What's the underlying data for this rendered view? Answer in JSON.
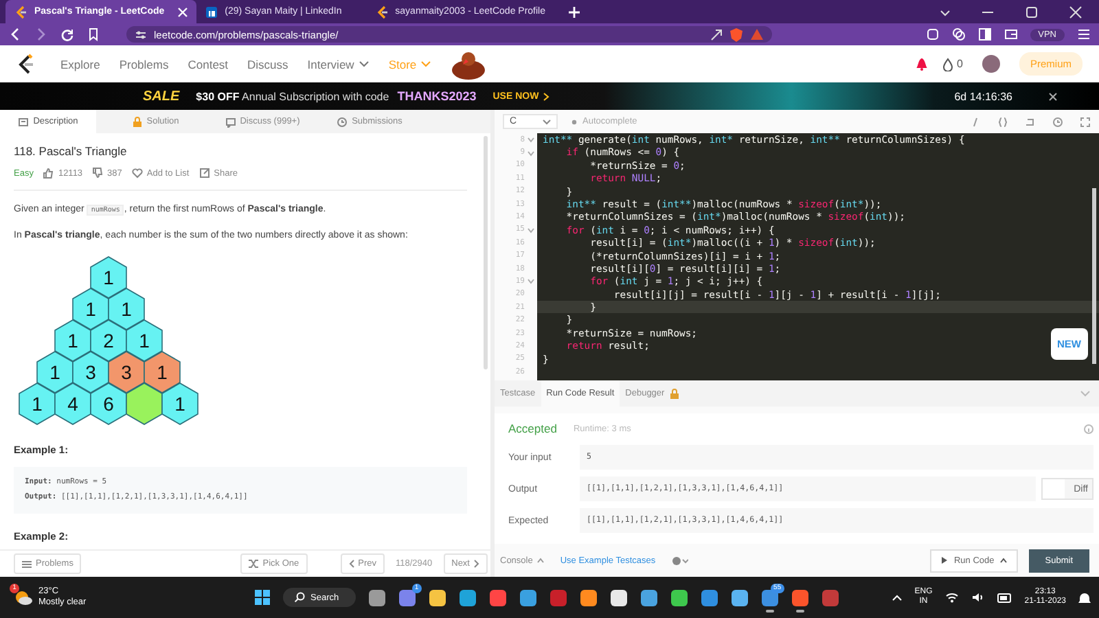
{
  "browser": {
    "tabs": [
      {
        "title": "Pascal's Triangle - LeetCode",
        "selected": true
      },
      {
        "title": "(29) Sayan Maity | LinkedIn",
        "selected": false
      },
      {
        "title": "sayanmaity2003 - LeetCode Profile",
        "selected": false
      }
    ],
    "address": "leetcode.com/problems/pascals-triangle/",
    "vpn": "VPN"
  },
  "nav": {
    "items": [
      {
        "label": "Explore",
        "kind": "plain"
      },
      {
        "label": "Problems",
        "kind": "plain"
      },
      {
        "label": "Contest",
        "kind": "plain"
      },
      {
        "label": "Discuss",
        "kind": "plain"
      },
      {
        "label": "Interview",
        "kind": "menu"
      },
      {
        "label": "Store",
        "kind": "store"
      }
    ],
    "coins": "0",
    "premium": "Premium"
  },
  "promo": {
    "sale": "SALE",
    "text": "**$30 OFF** Annual Subscription with code",
    "code": "THANKS2023",
    "action": "USE NOW",
    "timer": "6d 14:16:36"
  },
  "panel_tabs": [
    {
      "label": "Description",
      "selected": true
    },
    {
      "label": "Solution",
      "selected": false
    },
    {
      "label": "Discuss (999+)",
      "selected": false
    },
    {
      "label": "Submissions",
      "selected": false
    }
  ],
  "problem": {
    "title": "118. Pascal's Triangle",
    "difficulty": "Easy",
    "likes": "12113",
    "dislikes": "387",
    "add_to_list": "Add to List",
    "share": "Share",
    "paragraphs": [
      [
        {
          "kind": "text",
          "text": "Given an integer "
        },
        {
          "kind": "code",
          "text": "numRows"
        },
        {
          "kind": "text",
          "text": ", return the first numRows of **Pascal's triangle**."
        }
      ],
      [
        {
          "kind": "text",
          "text": "In **Pascal's triangle**, each number is the sum of the two numbers directly above it as shown:"
        }
      ]
    ],
    "figure": {
      "rows": [
        [
          {
            "label": "1",
            "color": "#66f2f2"
          }
        ],
        [
          {
            "label": "1",
            "color": "#66f2f2"
          },
          {
            "label": "1",
            "color": "#66f2f2"
          }
        ],
        [
          {
            "label": "1",
            "color": "#66f2f2"
          },
          {
            "label": "2",
            "color": "#66f2f2"
          },
          {
            "label": "1",
            "color": "#66f2f2"
          }
        ],
        [
          {
            "label": "1",
            "color": "#66f2f2"
          },
          {
            "label": "3",
            "color": "#66f2f2"
          },
          {
            "label": "3",
            "color": "#f2966b"
          },
          {
            "label": "1",
            "color": "#f2966b"
          }
        ],
        [
          {
            "label": "1",
            "color": "#66f2f2"
          },
          {
            "label": "4",
            "color": "#66f2f2"
          },
          {
            "label": "6",
            "color": "#66f2f2"
          },
          {
            "color": "#99f25c"
          },
          {
            "label": "1",
            "color": "#66f2f2"
          }
        ]
      ]
    },
    "examples": [
      {
        "heading": "Example 1:",
        "lines": [
          "**Input:** numRows = 5",
          "**Output:** [[1],[1,1],[1,2,1],[1,3,3,1],[1,4,6,4,1]]"
        ]
      },
      {
        "heading": "Example 2:"
      }
    ]
  },
  "bottom_bar": {
    "problems": "Problems",
    "pick": "Pick One",
    "prev": "Prev",
    "count": "118/2940",
    "next": "Next"
  },
  "editor": {
    "language": "C",
    "autocomplete": "Autocomplete",
    "new_badge": "NEW",
    "lines": [
      {
        "n": "8",
        "fold": true,
        "current": false,
        "segs": [
          {
            "kind": "type",
            "text": "int**"
          },
          {
            "kind": "plain",
            "text": " generate("
          },
          {
            "kind": "type",
            "text": "int"
          },
          {
            "kind": "plain",
            "text": " numRows, "
          },
          {
            "kind": "type",
            "text": "int*"
          },
          {
            "kind": "plain",
            "text": " returnSize, "
          },
          {
            "kind": "type",
            "text": "int**"
          },
          {
            "kind": "plain",
            "text": " returnColumnSizes) {"
          }
        ]
      },
      {
        "n": "9",
        "fold": true,
        "current": false,
        "segs": [
          {
            "kind": "keyword",
            "text": "    if"
          },
          {
            "kind": "plain",
            "text": " (numRows <= "
          },
          {
            "kind": "number",
            "text": "0"
          },
          {
            "kind": "plain",
            "text": ") {"
          }
        ]
      },
      {
        "n": "10",
        "fold": false,
        "current": false,
        "segs": [
          {
            "kind": "plain",
            "text": "        *returnSize = "
          },
          {
            "kind": "number",
            "text": "0"
          },
          {
            "kind": "plain",
            "text": ";"
          }
        ]
      },
      {
        "n": "11",
        "fold": false,
        "current": false,
        "segs": [
          {
            "kind": "keyword",
            "text": "        return"
          },
          {
            "kind": "number",
            "text": " NULL"
          },
          {
            "kind": "plain",
            "text": ";"
          }
        ]
      },
      {
        "n": "12",
        "fold": false,
        "current": false,
        "segs": [
          {
            "kind": "plain",
            "text": "    }"
          }
        ]
      },
      {
        "n": "13",
        "fold": false,
        "current": false,
        "segs": [
          {
            "kind": "type",
            "text": "    int**"
          },
          {
            "kind": "plain",
            "text": " result = ("
          },
          {
            "kind": "type",
            "text": "int**"
          },
          {
            "kind": "plain",
            "text": ")malloc(numRows * "
          },
          {
            "kind": "keyword",
            "text": "sizeof"
          },
          {
            "kind": "plain",
            "text": "("
          },
          {
            "kind": "type",
            "text": "int*"
          },
          {
            "kind": "plain",
            "text": "));"
          }
        ]
      },
      {
        "n": "14",
        "fold": false,
        "current": false,
        "segs": [
          {
            "kind": "plain",
            "text": "    *returnColumnSizes = ("
          },
          {
            "kind": "type",
            "text": "int*"
          },
          {
            "kind": "plain",
            "text": ")malloc(numRows * "
          },
          {
            "kind": "keyword",
            "text": "sizeof"
          },
          {
            "kind": "plain",
            "text": "("
          },
          {
            "kind": "type",
            "text": "int"
          },
          {
            "kind": "plain",
            "text": "));"
          }
        ]
      },
      {
        "n": "15",
        "fold": true,
        "current": false,
        "segs": [
          {
            "kind": "keyword",
            "text": "    for"
          },
          {
            "kind": "plain",
            "text": " ("
          },
          {
            "kind": "type",
            "text": "int"
          },
          {
            "kind": "plain",
            "text": " i = "
          },
          {
            "kind": "number",
            "text": "0"
          },
          {
            "kind": "plain",
            "text": "; i < numRows; i++) {"
          }
        ]
      },
      {
        "n": "16",
        "fold": false,
        "current": false,
        "segs": [
          {
            "kind": "plain",
            "text": "        result[i] = ("
          },
          {
            "kind": "type",
            "text": "int*"
          },
          {
            "kind": "plain",
            "text": ")malloc((i + "
          },
          {
            "kind": "number",
            "text": "1"
          },
          {
            "kind": "plain",
            "text": ") * "
          },
          {
            "kind": "keyword",
            "text": "sizeof"
          },
          {
            "kind": "plain",
            "text": "("
          },
          {
            "kind": "type",
            "text": "int"
          },
          {
            "kind": "plain",
            "text": "));"
          }
        ]
      },
      {
        "n": "17",
        "fold": false,
        "current": false,
        "segs": [
          {
            "kind": "plain",
            "text": "        (*returnColumnSizes)[i] = i + "
          },
          {
            "kind": "number",
            "text": "1"
          },
          {
            "kind": "plain",
            "text": ";"
          }
        ]
      },
      {
        "n": "18",
        "fold": false,
        "current": false,
        "segs": [
          {
            "kind": "plain",
            "text": "        result[i]["
          },
          {
            "kind": "number",
            "text": "0"
          },
          {
            "kind": "plain",
            "text": "] = result[i][i] = "
          },
          {
            "kind": "number",
            "text": "1"
          },
          {
            "kind": "plain",
            "text": ";"
          }
        ]
      },
      {
        "n": "19",
        "fold": true,
        "current": false,
        "segs": [
          {
            "kind": "keyword",
            "text": "        for"
          },
          {
            "kind": "plain",
            "text": " ("
          },
          {
            "kind": "type",
            "text": "int"
          },
          {
            "kind": "plain",
            "text": " j = "
          },
          {
            "kind": "number",
            "text": "1"
          },
          {
            "kind": "plain",
            "text": "; j < i; j++) {"
          }
        ]
      },
      {
        "n": "20",
        "fold": false,
        "current": false,
        "segs": [
          {
            "kind": "plain",
            "text": "            result[i][j] = result[i - "
          },
          {
            "kind": "number",
            "text": "1"
          },
          {
            "kind": "plain",
            "text": "][j - "
          },
          {
            "kind": "number",
            "text": "1"
          },
          {
            "kind": "plain",
            "text": "] + result[i - "
          },
          {
            "kind": "number",
            "text": "1"
          },
          {
            "kind": "plain",
            "text": "][j];"
          }
        ]
      },
      {
        "n": "21",
        "fold": false,
        "current": true,
        "segs": [
          {
            "kind": "plain",
            "text": "        }"
          }
        ]
      },
      {
        "n": "22",
        "fold": false,
        "current": false,
        "segs": [
          {
            "kind": "plain",
            "text": "    }"
          }
        ]
      },
      {
        "n": "23",
        "fold": false,
        "current": false,
        "segs": [
          {
            "kind": "plain",
            "text": "    *returnSize = numRows;"
          }
        ]
      },
      {
        "n": "24",
        "fold": false,
        "current": false,
        "segs": [
          {
            "kind": "keyword",
            "text": "    return"
          },
          {
            "kind": "plain",
            "text": " result;"
          }
        ]
      },
      {
        "n": "25",
        "fold": false,
        "current": false,
        "segs": [
          {
            "kind": "plain",
            "text": "}"
          }
        ]
      },
      {
        "n": "26",
        "fold": false,
        "current": false
      }
    ]
  },
  "result": {
    "tabs": [
      {
        "label": "Testcase",
        "selected": false,
        "locked": false
      },
      {
        "label": "Run Code Result",
        "selected": true,
        "locked": false
      },
      {
        "label": "Debugger",
        "selected": false,
        "locked": true
      }
    ],
    "status": "Accepted",
    "runtime": "Runtime: 3 ms",
    "rows": [
      {
        "label": "Your input",
        "value": "5",
        "kind": "plain"
      },
      {
        "label": "Output",
        "value": "[[1],[1,1],[1,2,1],[1,3,3,1],[1,4,6,4,1]]",
        "kind": "diff"
      },
      {
        "label": "Expected",
        "value": "[[1],[1,1],[1,2,1],[1,3,3,1],[1,4,6,4,1]]",
        "kind": "plain"
      }
    ],
    "diff": "Diff",
    "diff_on": false,
    "console": "Console",
    "examples": "Use Example Testcases",
    "run": "Run Code",
    "submit": "Submit"
  },
  "taskbar": {
    "weather_badge": "1",
    "temp": "23°C",
    "weather": "Mostly clear",
    "search": "Search",
    "apps": [
      {
        "color": "#9a9a9a",
        "active": false
      },
      {
        "color": "#7b83eb",
        "badge": "1",
        "active": false
      },
      {
        "color": "#f5c342",
        "active": false
      },
      {
        "color": "#1fa3d8",
        "active": false
      },
      {
        "color": "#ff4545",
        "active": false
      },
      {
        "color": "#3aa0e0",
        "active": false
      },
      {
        "color": "#c8202a",
        "active": false
      },
      {
        "color": "#ff8a1f",
        "active": false
      },
      {
        "color": "#e8e8e8",
        "active": false
      },
      {
        "color": "#4aa3df",
        "active": false
      },
      {
        "color": "#3ec84d",
        "active": false
      },
      {
        "color": "#2f8fe0",
        "active": false
      },
      {
        "color": "#5ab3f0",
        "active": false
      },
      {
        "color": "#3c8fe0",
        "badge": "55",
        "active": true
      },
      {
        "color": "#fb542b",
        "active": true
      },
      {
        "color": "#c23a3a",
        "active": false
      }
    ],
    "lang": "ENG",
    "region": "IN",
    "time": "23:13",
    "date": "21-11-2023"
  }
}
